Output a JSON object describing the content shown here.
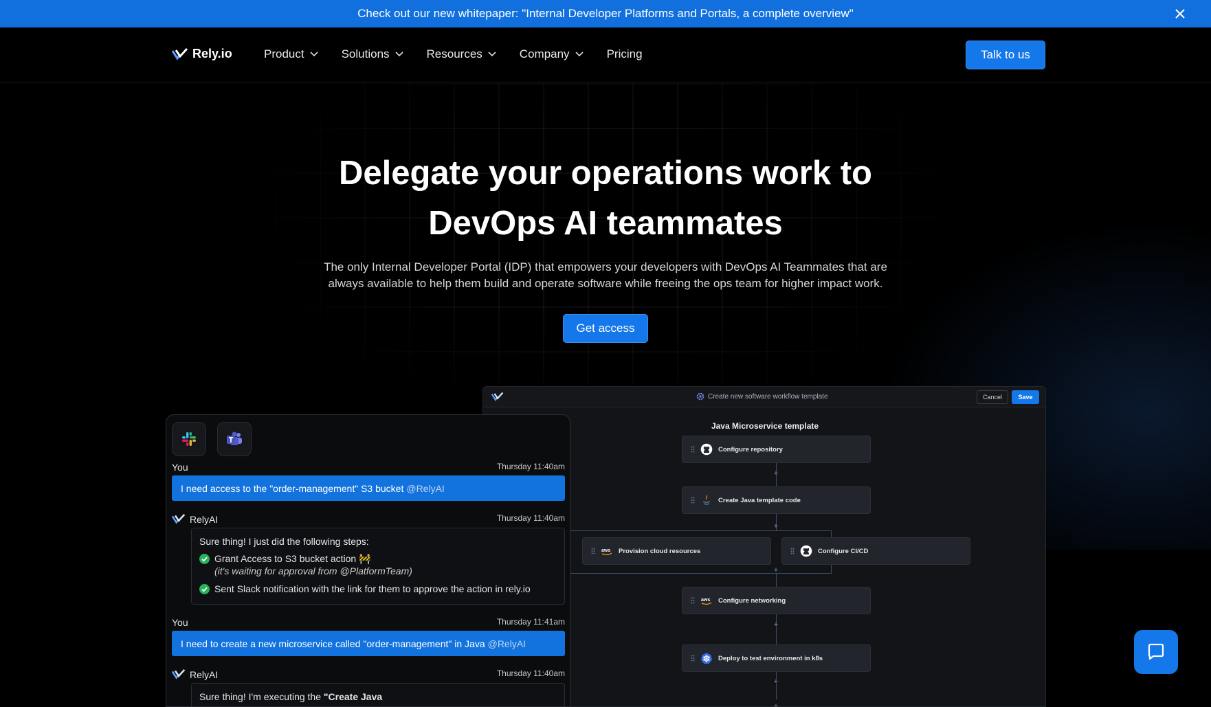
{
  "announcement": {
    "text": "Check out our new whitepaper: \"Internal Developer Platforms and Portals, a complete overview\"",
    "close_icon": "close-icon"
  },
  "nav": {
    "brand": "Rely.io",
    "items": [
      {
        "label": "Product",
        "has_dropdown": true
      },
      {
        "label": "Solutions",
        "has_dropdown": true
      },
      {
        "label": "Resources",
        "has_dropdown": true
      },
      {
        "label": "Company",
        "has_dropdown": true
      },
      {
        "label": "Pricing",
        "has_dropdown": false
      }
    ],
    "cta": "Talk to us"
  },
  "hero": {
    "title_line1": "Delegate your operations work to",
    "title_line2": "DevOps AI teammates",
    "subtitle_line1": "The only Internal Developer Portal (IDP) that empowers your developers with DevOps AI Teammates that are",
    "subtitle_line2": "always available to help them build and operate software while freeing the ops team for higher impact work.",
    "cta": "Get access"
  },
  "workflow": {
    "header_title": "Create new software workflow template",
    "cancel": "Cancel",
    "save": "Save",
    "template_title": "Java Microservice template",
    "nodes": {
      "repo": "Configure repository",
      "java": "Create Java template code",
      "cloud": "Provision cloud resources",
      "cicd": "Configure CI/CD",
      "network": "Configure networking",
      "deploy": "Deploy to test environment in k8s"
    },
    "plus": "+"
  },
  "chat": {
    "apps": [
      "slack-icon",
      "teams-icon"
    ],
    "messages": [
      {
        "who": "You",
        "when": "Thursday 11:40am",
        "text": "I need access to the \"order-management\" S3 bucket",
        "mention": "@RelyAI"
      },
      {
        "who": "RelyAI",
        "when": "Thursday 11:40am",
        "intro": "Sure thing! I just did the following steps:",
        "step1": "Grant Access to S3 bucket action 🚧",
        "step1_sub_prefix": "(it's waiting for approval from ",
        "step1_sub_team": "@PlatformTeam",
        "step1_sub_suffix": ")",
        "step2": "Sent Slack notification with the link for them to approve the action in rely.io"
      },
      {
        "who": "You",
        "when": "Thursday 11:41am",
        "text": "I need to create a new microservice called \"order-management\" in Java",
        "mention": "@RelyAI"
      },
      {
        "who": "RelyAI",
        "when": "Thursday 11:40am",
        "intro_prefix": "Sure thing! I'm executing the ",
        "intro_bold": "\"Create Java"
      }
    ]
  },
  "widget": {
    "icon": "chat-bubble-icon"
  },
  "colors": {
    "accent": "#1477ea",
    "announcement": "#1170dd",
    "background": "#000000"
  }
}
